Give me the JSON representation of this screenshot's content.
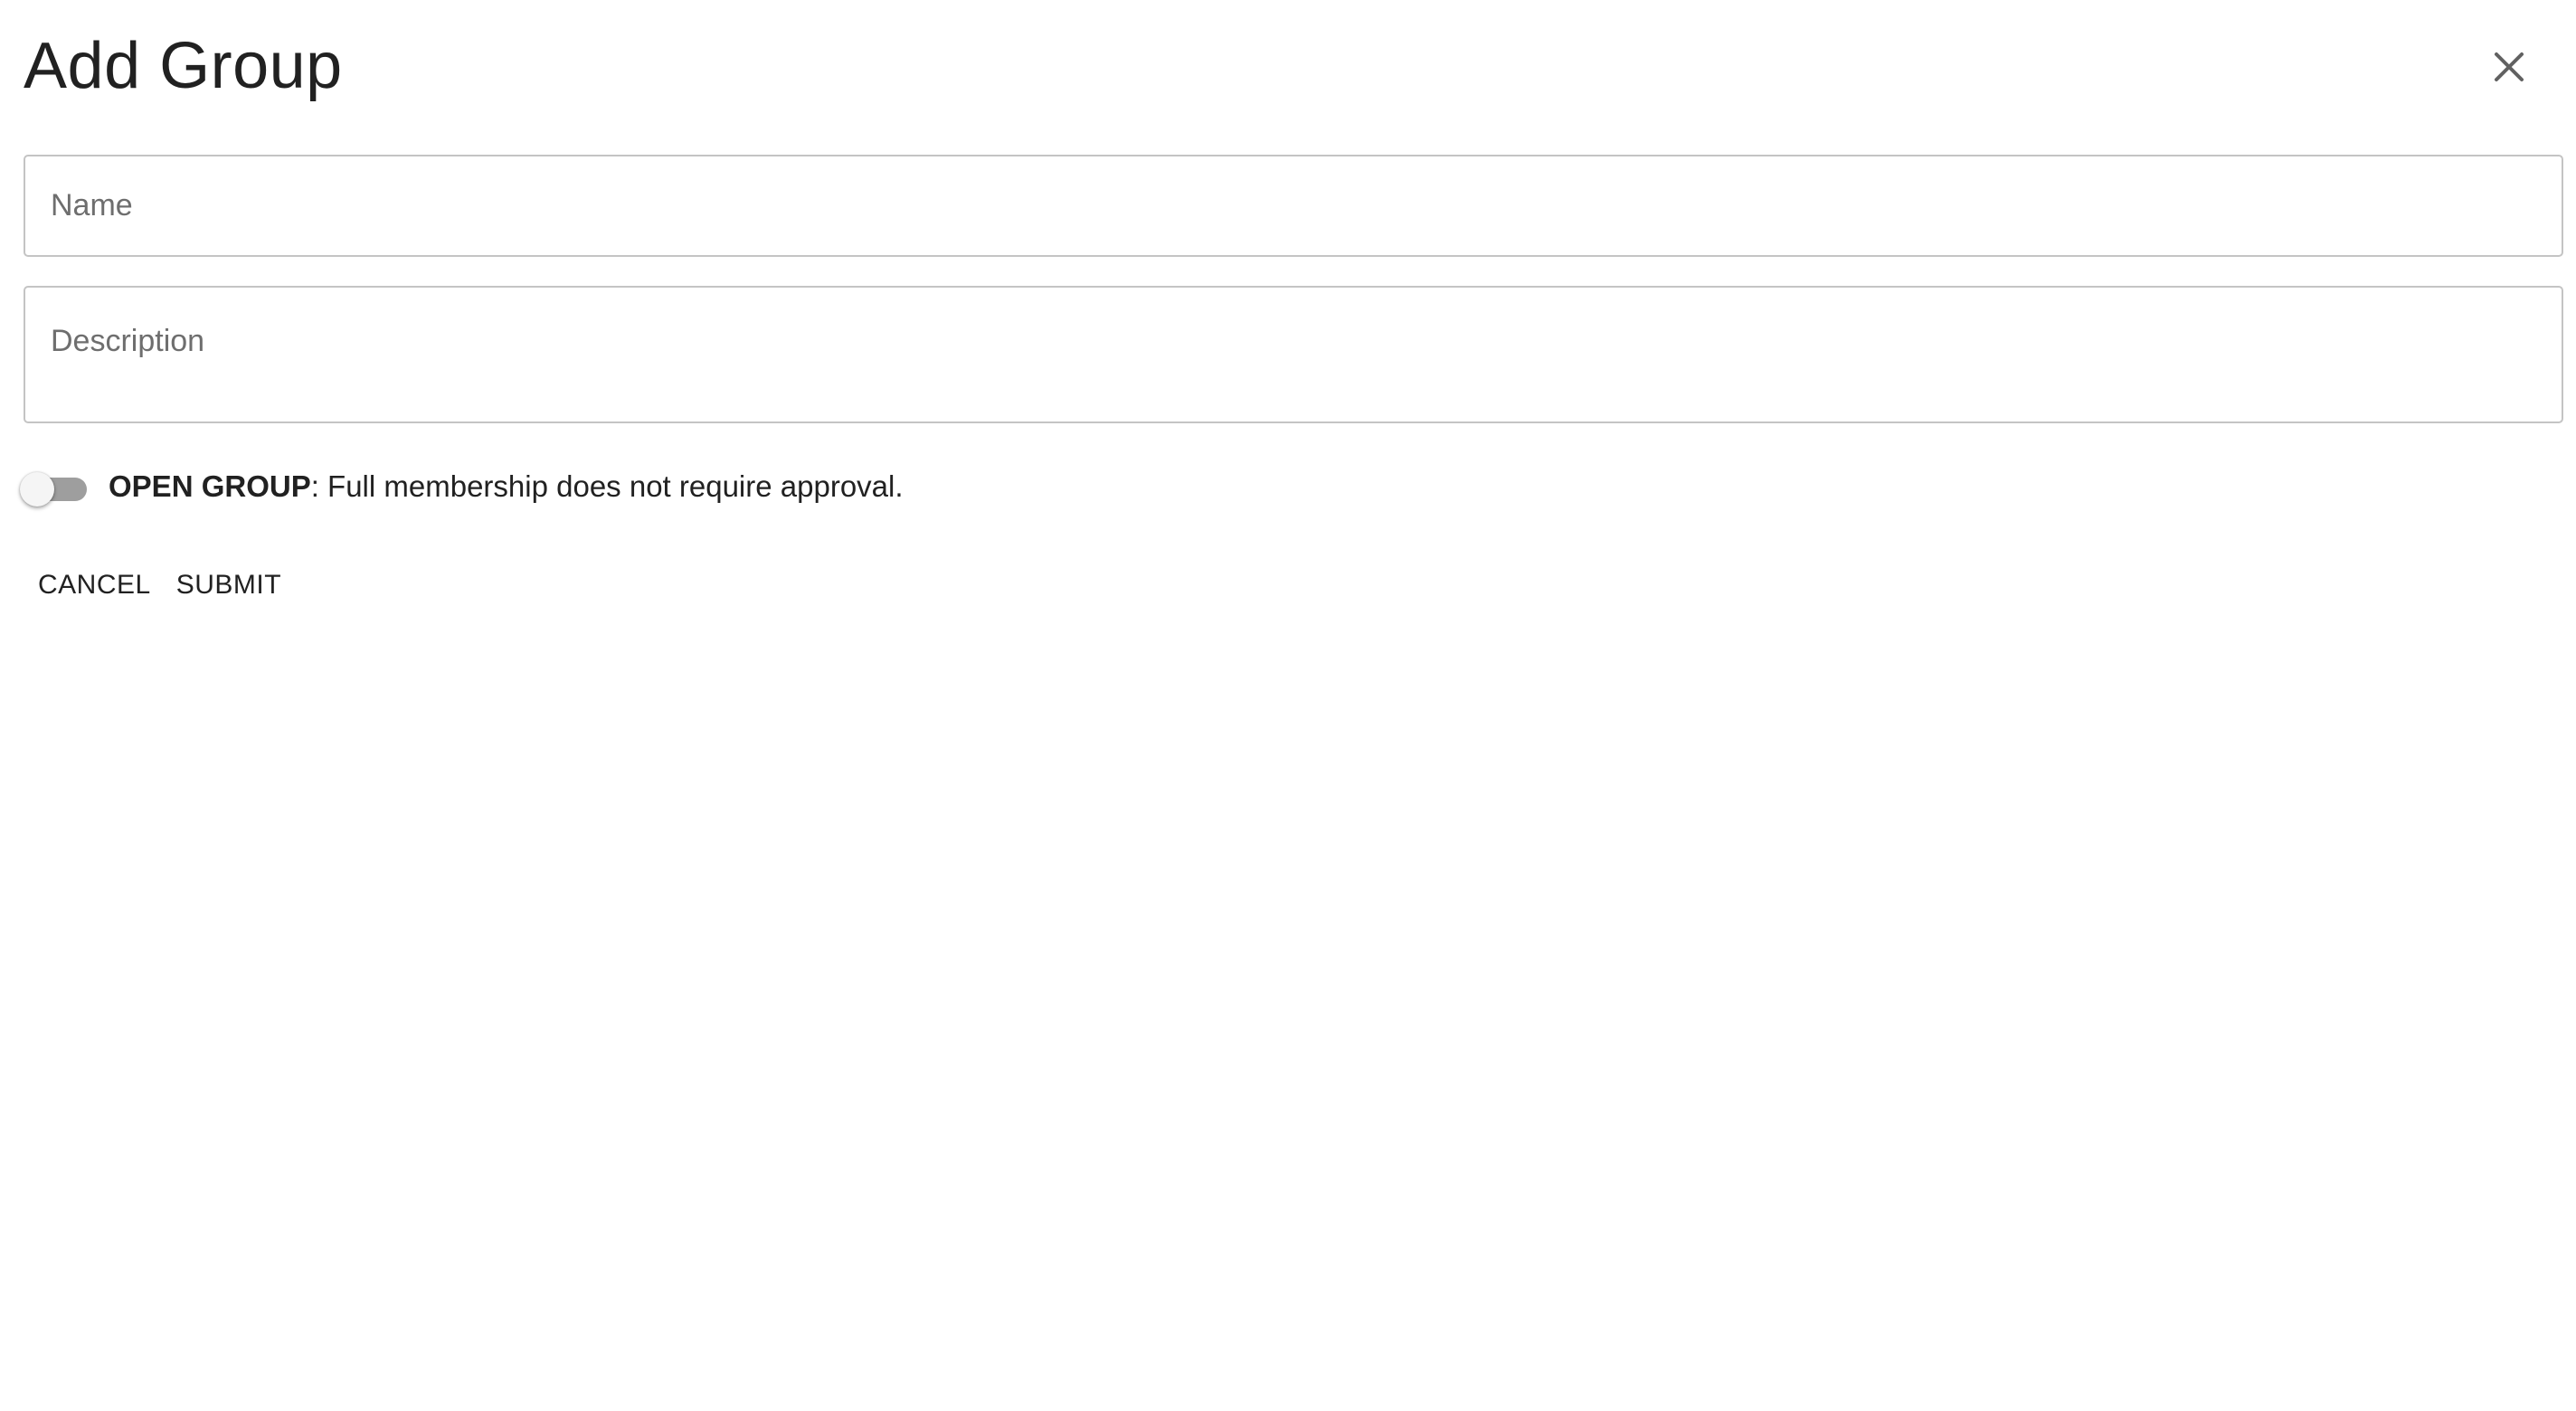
{
  "dialog": {
    "title": "Add Group",
    "close_icon": "close-icon"
  },
  "form": {
    "name": {
      "placeholder": "Name",
      "value": ""
    },
    "description": {
      "placeholder": "Description",
      "value": ""
    },
    "open_group": {
      "label_strong": "OPEN GROUP",
      "label_rest": ": Full membership does not require approval.",
      "checked": false
    }
  },
  "actions": {
    "cancel_label": "CANCEL",
    "submit_label": "SUBMIT"
  },
  "colors": {
    "text": "#212121",
    "border": "#c4c4c4",
    "placeholder": "#6e6e6e",
    "switch_track": "#9e9e9e",
    "switch_thumb": "#f5f5f5"
  }
}
